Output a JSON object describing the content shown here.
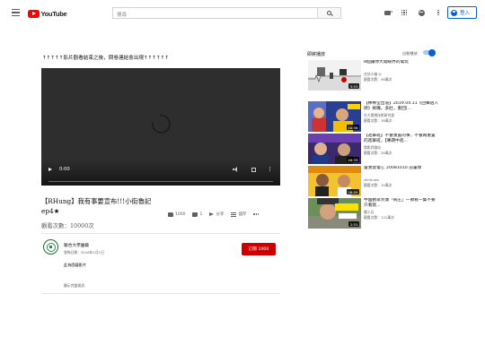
{
  "header": {
    "logo_text": "YouTube",
    "search_placeholder": "搜尋",
    "signin_label": "登入"
  },
  "player": {
    "notice": "↑↑↑↑↑影片觀看結束之後，問卷連結會出現↑↑↑↑↑↑",
    "time": "0:00"
  },
  "video": {
    "title": "【RHung】我有事要宣布!!!小街魯記 ep4★",
    "views": "觀看次數：10000次",
    "likes": "1000",
    "dislikes": "1",
    "share_label": "分享",
    "save_label": "儲存"
  },
  "channel": {
    "name": "聯合大學園藝",
    "published": "發佈日期：2016年1月1日",
    "subscribe_label": "訂閱 1000",
    "description": "此為園藝影片",
    "show_more": "顯示完整資訊"
  },
  "sidebar": {
    "up_next": "即將播放",
    "autoplay": "自動播放",
    "items": [
      {
        "title": "8個讓你大開眼界的電玩",
        "channel": "芝伕小貓 ◎",
        "views": "觀看次數：96萬次",
        "duration": "5:53",
        "thumb": "game"
      },
      {
        "title": "【棒棒堂出道】2019.04.11《回聲逍人牌》搞職，多壯，重回[…",
        "channel": "台大電視技術研究部",
        "views": "觀看次數：36萬次",
        "duration": "40:56",
        "thumb": "variety"
      },
      {
        "title": "【進擊班】不會重置的事，不會再重置的進擊班，【專題中進…",
        "channel": "電影評論站",
        "views": "觀看次數：26萬次",
        "duration": "46:39",
        "thumb": "show"
      },
      {
        "title": "還我發電它 20081010 前輩傑",
        "channel": "zhhhuais",
        "views": "觀看次數：15萬次",
        "duration": "26:09",
        "thumb": "people"
      },
      {
        "title": "中國觀眾笑爆「碗王」一節看一集不要只看就…",
        "channel": "暖小兵",
        "views": "觀看次數：131萬次",
        "duration": "2:53",
        "thumb": "street"
      }
    ]
  }
}
